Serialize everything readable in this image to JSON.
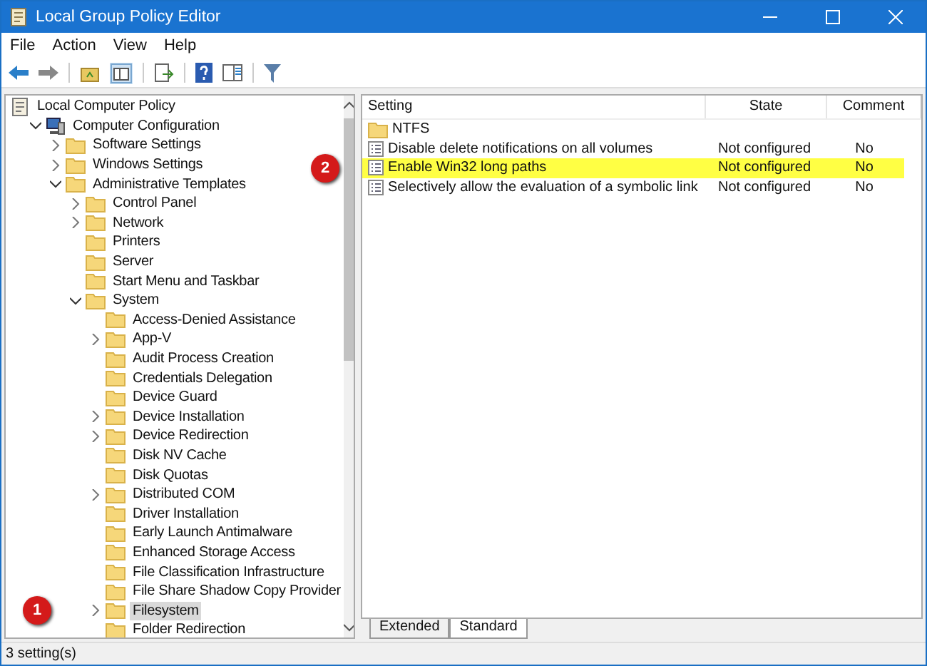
{
  "window": {
    "title": "Local Group Policy Editor"
  },
  "menu": [
    "File",
    "Action",
    "View",
    "Help"
  ],
  "tree": [
    {
      "label": "Local Computer Policy",
      "kind": "root",
      "expandable": false,
      "selected": false,
      "children": [
        {
          "label": "Computer Configuration",
          "kind": "computer",
          "expandable": true,
          "expanded": true,
          "selected": false,
          "children": [
            {
              "label": "Software Settings",
              "kind": "folder",
              "expandable": true,
              "expanded": false,
              "selected": false
            },
            {
              "label": "Windows Settings",
              "kind": "folder",
              "expandable": true,
              "expanded": false,
              "selected": false
            },
            {
              "label": "Administrative Templates",
              "kind": "folder",
              "expandable": true,
              "expanded": true,
              "selected": false,
              "children": [
                {
                  "label": "Control Panel",
                  "kind": "folder",
                  "expandable": true,
                  "expanded": false,
                  "selected": false
                },
                {
                  "label": "Network",
                  "kind": "folder",
                  "expandable": true,
                  "expanded": false,
                  "selected": false
                },
                {
                  "label": "Printers",
                  "kind": "folder",
                  "expandable": false,
                  "selected": false
                },
                {
                  "label": "Server",
                  "kind": "folder",
                  "expandable": false,
                  "selected": false
                },
                {
                  "label": "Start Menu and Taskbar",
                  "kind": "folder",
                  "expandable": false,
                  "selected": false
                },
                {
                  "label": "System",
                  "kind": "folder",
                  "expandable": true,
                  "expanded": true,
                  "selected": false,
                  "children": [
                    {
                      "label": "Access-Denied Assistance",
                      "kind": "folder",
                      "expandable": false,
                      "selected": false
                    },
                    {
                      "label": "App-V",
                      "kind": "folder",
                      "expandable": true,
                      "expanded": false,
                      "selected": false
                    },
                    {
                      "label": "Audit Process Creation",
                      "kind": "folder",
                      "expandable": false,
                      "selected": false
                    },
                    {
                      "label": "Credentials Delegation",
                      "kind": "folder",
                      "expandable": false,
                      "selected": false
                    },
                    {
                      "label": "Device Guard",
                      "kind": "folder",
                      "expandable": false,
                      "selected": false
                    },
                    {
                      "label": "Device Installation",
                      "kind": "folder",
                      "expandable": true,
                      "expanded": false,
                      "selected": false
                    },
                    {
                      "label": "Device Redirection",
                      "kind": "folder",
                      "expandable": true,
                      "expanded": false,
                      "selected": false
                    },
                    {
                      "label": "Disk NV Cache",
                      "kind": "folder",
                      "expandable": false,
                      "selected": false
                    },
                    {
                      "label": "Disk Quotas",
                      "kind": "folder",
                      "expandable": false,
                      "selected": false
                    },
                    {
                      "label": "Distributed COM",
                      "kind": "folder",
                      "expandable": true,
                      "expanded": false,
                      "selected": false
                    },
                    {
                      "label": "Driver Installation",
                      "kind": "folder",
                      "expandable": false,
                      "selected": false
                    },
                    {
                      "label": "Early Launch Antimalware",
                      "kind": "folder",
                      "expandable": false,
                      "selected": false
                    },
                    {
                      "label": "Enhanced Storage Access",
                      "kind": "folder",
                      "expandable": false,
                      "selected": false
                    },
                    {
                      "label": "File Classification Infrastructure",
                      "kind": "folder",
                      "expandable": false,
                      "selected": false
                    },
                    {
                      "label": "File Share Shadow Copy Provider",
                      "kind": "folder",
                      "expandable": false,
                      "selected": false
                    },
                    {
                      "label": "Filesystem",
                      "kind": "folder",
                      "expandable": true,
                      "expanded": false,
                      "selected": true,
                      "callout": "1"
                    },
                    {
                      "label": "Folder Redirection",
                      "kind": "folder",
                      "expandable": false,
                      "selected": false
                    }
                  ]
                }
              ]
            }
          ]
        }
      ]
    }
  ],
  "table": {
    "columns": [
      "Setting",
      "State",
      "Comment"
    ],
    "rows": [
      {
        "kind": "folder",
        "setting": "NTFS",
        "highlighted": false
      },
      {
        "kind": "setting",
        "setting": "Disable delete notifications on all volumes",
        "state": "Not configured",
        "comment": "No",
        "highlighted": false
      },
      {
        "kind": "setting",
        "setting": "Enable Win32 long paths",
        "state": "Not configured",
        "comment": "No",
        "highlighted": true,
        "callout": "2"
      },
      {
        "kind": "setting",
        "setting": "Selectively allow the evaluation of a symbolic link",
        "state": "Not configured",
        "comment": "No",
        "highlighted": false
      }
    ]
  },
  "view_tabs": [
    {
      "label": "Extended",
      "selected": false
    },
    {
      "label": "Standard",
      "selected": true
    }
  ],
  "status_bar": "3 setting(s)"
}
